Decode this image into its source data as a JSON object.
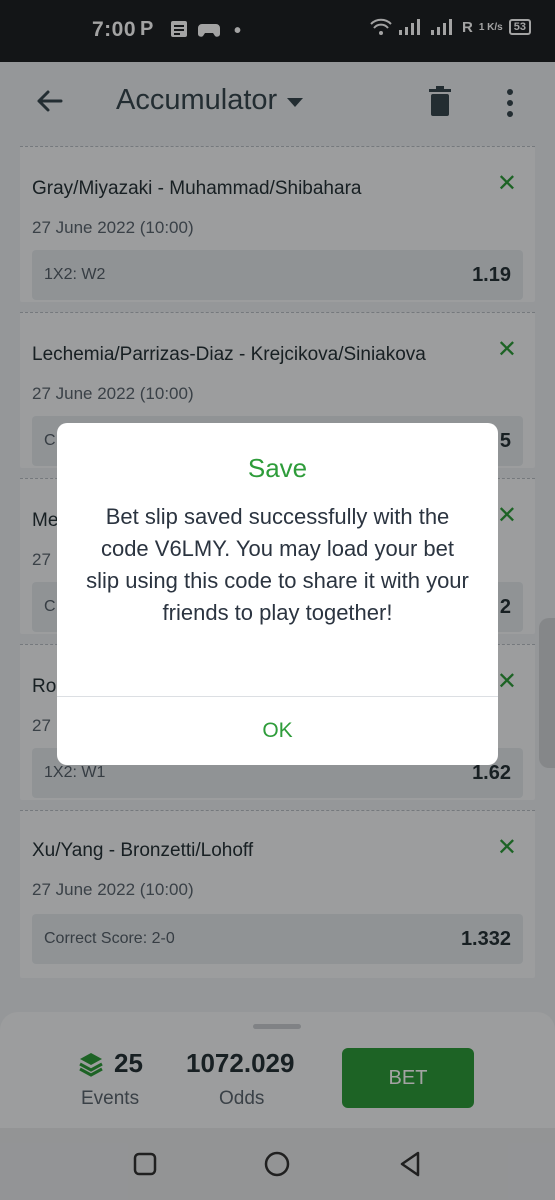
{
  "status_bar": {
    "time": "7:00",
    "left_icons": [
      "parking-icon",
      "message-icon",
      "game-controller-icon",
      "dot-icon"
    ],
    "net_label": "R",
    "speed": "1 K/s",
    "battery": "53"
  },
  "app_bar": {
    "title": "Accumulator"
  },
  "bets": [
    {
      "match": "Gray/Miyazaki - Muhammad/Shibahara",
      "date": "27 June 2022 (10:00)",
      "market": "1X2: W2",
      "odds": "1.19"
    },
    {
      "match": "Lechemia/Parrizas-Diaz - Krejcikova/Siniakova",
      "date": "27 June 2022 (10:00)",
      "market": "C",
      "odds": "5"
    },
    {
      "match": "Me",
      "date": "27",
      "market": "C",
      "odds": "2"
    },
    {
      "match": "Ro",
      "date": "27",
      "market": "1X2: W1",
      "odds": "1.62"
    },
    {
      "match": "Xu/Yang - Bronzetti/Lohoff",
      "date": "27 June 2022 (10:00)",
      "market": "Correct Score: 2-0",
      "odds": "1.332"
    }
  ],
  "summary": {
    "events_count": "25",
    "events_label": "Events",
    "odds_value": "1072.029",
    "odds_label": "Odds",
    "bet_label": "BET"
  },
  "dialog": {
    "title": "Save",
    "message": "Bet slip saved successfully with the code V6LMY. You may load your bet slip using this code to share it with your friends to play together!",
    "ok_label": "OK"
  },
  "colors": {
    "accent": "#2e9c3a",
    "status_bar": "#1e2125",
    "background": "#e9ecef"
  }
}
